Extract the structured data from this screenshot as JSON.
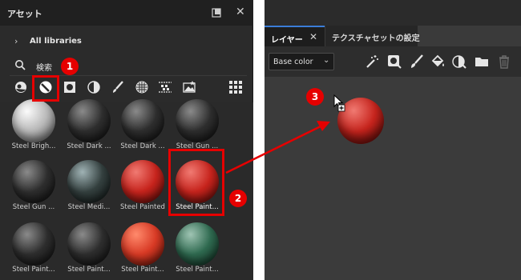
{
  "assets_panel": {
    "title": "アセット",
    "libraries_label": "All libraries",
    "search_label": "検索"
  },
  "materials": [
    {
      "label": "Steel Brigh...",
      "kind": "silver"
    },
    {
      "label": "Steel Dark ...",
      "kind": "dark"
    },
    {
      "label": "Steel Dark ...",
      "kind": "dark"
    },
    {
      "label": "Steel Gun ...",
      "kind": "dark"
    },
    {
      "label": "Steel Gun ...",
      "kind": "dark"
    },
    {
      "label": "Steel Medi...",
      "kind": "teal"
    },
    {
      "label": "Steel Painted",
      "kind": "red"
    },
    {
      "label": "Steel Paint...",
      "kind": "red"
    },
    {
      "label": "Steel Paint...",
      "kind": "dark"
    },
    {
      "label": "Steel Paint...",
      "kind": "dark"
    },
    {
      "label": "Steel Paint...",
      "kind": "redorange"
    },
    {
      "label": "Steel Paint...",
      "kind": "green"
    }
  ],
  "layers_panel": {
    "tab_layers": "レイヤー",
    "tab_texture": "テクスチャセットの設定",
    "channel_select": "Base color"
  },
  "annotations": {
    "step1": "1",
    "step2": "2",
    "step3": "3"
  },
  "colors": {
    "highlight": "#e60000",
    "tab_accent": "#3b7dd8"
  },
  "icons": [
    "expand-icon",
    "close-icon",
    "chevron-right-icon",
    "search-icon",
    "material-ball-icon",
    "smart-material-icon",
    "mask-icon",
    "smart-mask-icon",
    "brush-icon",
    "pattern-icon",
    "particles-icon",
    "image-icon",
    "grid-view-icon",
    "magic-wand-icon",
    "mask-fill-icon",
    "paint-icon",
    "fill-icon",
    "smart-fill-icon",
    "folder-icon",
    "trash-icon"
  ]
}
